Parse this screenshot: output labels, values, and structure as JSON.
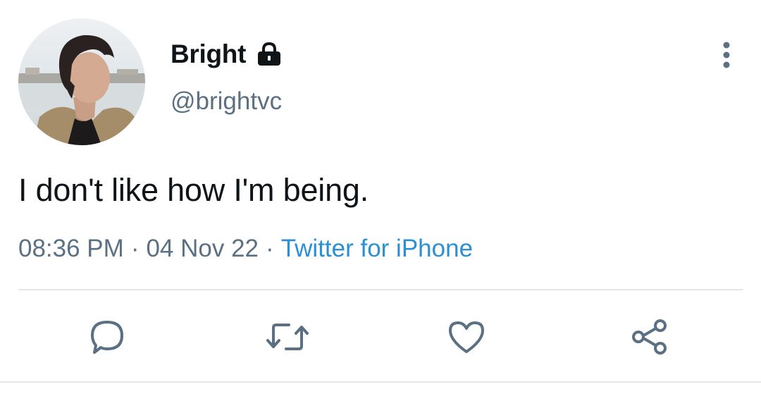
{
  "tweet": {
    "author": {
      "display_name": "Bright",
      "handle": "@brightvc",
      "protected_icon": "lock-icon",
      "avatar": "profile-photo"
    },
    "text": "I don't like how I'm being.",
    "meta": {
      "time": "08:36 PM",
      "separator": "·",
      "date": "04 Nov 22",
      "source": "Twitter for iPhone"
    },
    "actions": [
      {
        "name": "reply",
        "icon": "comment-icon"
      },
      {
        "name": "retweet",
        "icon": "retweet-icon"
      },
      {
        "name": "like",
        "icon": "heart-icon"
      },
      {
        "name": "share",
        "icon": "share-icon"
      }
    ],
    "menu_icon": "more-vertical-icon"
  },
  "colors": {
    "text_primary": "#0f1419",
    "text_secondary": "#5b7083",
    "link": "#2b8fd6",
    "icon": "#5b7083",
    "divider": "#e3e6e9"
  }
}
